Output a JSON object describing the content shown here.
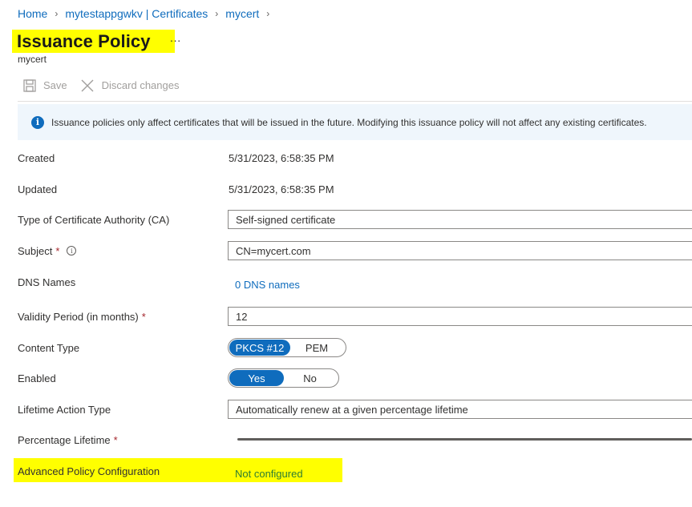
{
  "breadcrumb": [
    "Home",
    "mytestappgwkv | Certificates",
    "mycert"
  ],
  "page": {
    "title": "Issuance Policy",
    "more": "···",
    "subtitle": "mycert"
  },
  "toolbar": {
    "save_label": "Save",
    "discard_label": "Discard changes"
  },
  "info_message": "Issuance policies only affect certificates that will be issued in the future. Modifying this issuance policy will not affect any existing certificates.",
  "form": {
    "created_label": "Created",
    "created_value": "5/31/2023, 6:58:35 PM",
    "updated_label": "Updated",
    "updated_value": "5/31/2023, 6:58:35 PM",
    "ca_type_label": "Type of Certificate Authority (CA)",
    "ca_type_value": "Self-signed certificate",
    "subject_label": "Subject",
    "subject_value": "CN=mycert.com",
    "dns_label": "DNS Names",
    "dns_link": "0 DNS names",
    "validity_label": "Validity Period (in months)",
    "validity_value": "12",
    "content_type_label": "Content Type",
    "content_type_options": [
      "PKCS #12",
      "PEM"
    ],
    "content_type_selected": "PKCS #12",
    "enabled_label": "Enabled",
    "enabled_options": [
      "Yes",
      "No"
    ],
    "enabled_selected": "Yes",
    "lifetime_action_label": "Lifetime Action Type",
    "lifetime_action_value": "Automatically renew at a given percentage lifetime",
    "percentage_lifetime_label": "Percentage Lifetime",
    "advanced_label": "Advanced Policy Configuration",
    "advanced_link": "Not configured"
  },
  "required_marker": "*",
  "colors": {
    "accent": "#0f6cbd",
    "highlight": "#ffff00",
    "required": "#a4262c",
    "not_configured": "#2e7d32"
  },
  "icons": {
    "save": "save-icon",
    "discard": "close-icon",
    "info": "info-icon"
  }
}
